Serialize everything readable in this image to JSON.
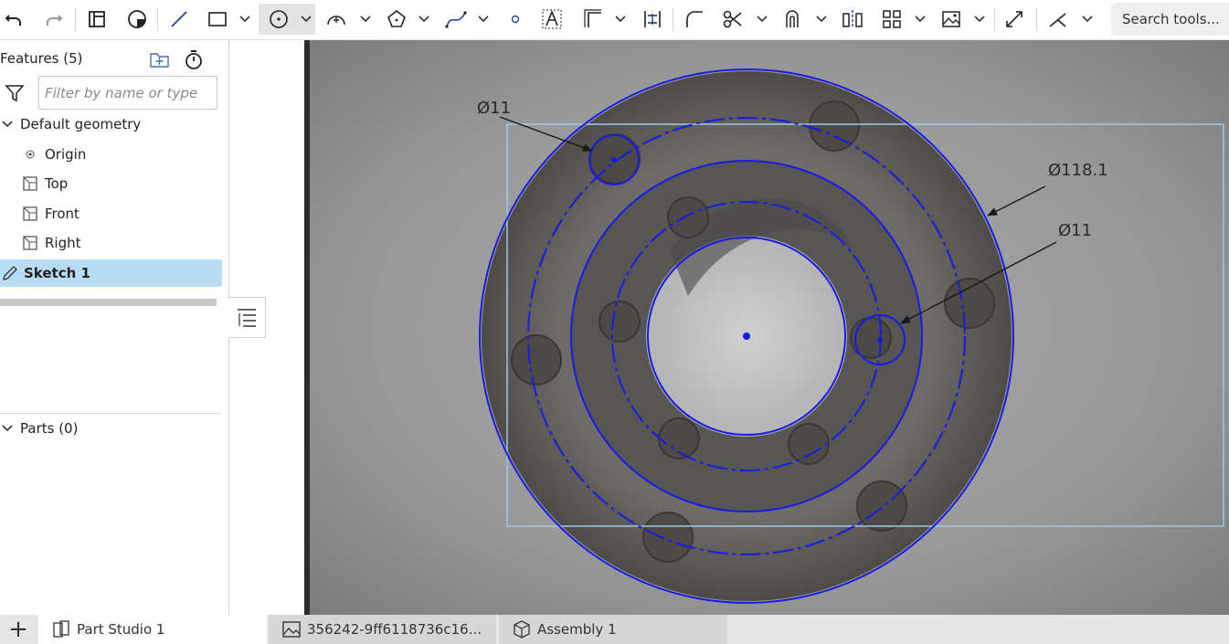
{
  "toolbar": {
    "icons": [
      "undo-icon",
      "redo-icon",
      "sketch-icon",
      "display-icon",
      "line-icon",
      "rectangle-icon",
      "circle-icon",
      "arc-icon",
      "polygon-icon",
      "spline-icon",
      "point-icon",
      "text-icon",
      "offset-icon",
      "dimension-icon",
      "fillet-icon",
      "trim-icon",
      "use-icon",
      "mirror-icon",
      "pattern-icon",
      "image-icon",
      "normal-icon",
      "axis-icon"
    ],
    "search_label": "Search tools..."
  },
  "panel": {
    "title": "Features (5)",
    "filter_placeholder": "Filter by name or type",
    "default_geometry": "Default geometry",
    "items": [
      {
        "label": "Origin",
        "icon": "origin-icon"
      },
      {
        "label": "Top",
        "icon": "plane-icon"
      },
      {
        "label": "Front",
        "icon": "plane-icon"
      },
      {
        "label": "Right",
        "icon": "plane-icon"
      }
    ],
    "sketch": "Sketch 1",
    "parts": "Parts (0)"
  },
  "viewport": {
    "dimensions": {
      "d1": "Ø11",
      "d2": "Ø118.1",
      "d3": "Ø11"
    }
  },
  "tabs": [
    {
      "label": "Part Studio 1",
      "icon": "part-studio-icon",
      "active": true
    },
    {
      "label": "356242-9ff6118736c16...",
      "icon": "image-icon",
      "active": false
    },
    {
      "label": "Assembly 1",
      "icon": "assembly-icon",
      "active": false
    }
  ],
  "colors": {
    "sketch_blue": "#1a1ae6",
    "selection_blue": "#b9dcf5",
    "image_border": "#9ec9e8"
  }
}
